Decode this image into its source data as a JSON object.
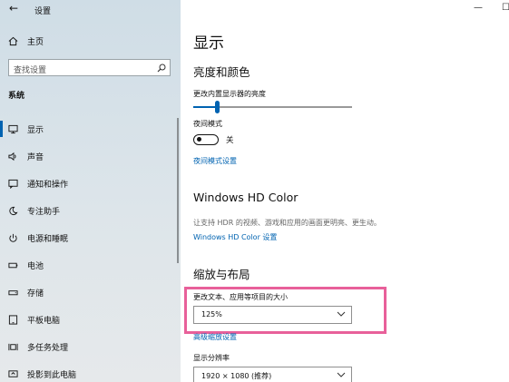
{
  "app": {
    "title": "设置",
    "back_icon": "back-arrow-icon"
  },
  "sidebar": {
    "home_label": "主页",
    "search_placeholder": "查找设置",
    "section_title": "系统",
    "items": [
      {
        "label": "显示",
        "icon": "display-icon",
        "active": true
      },
      {
        "label": "声音",
        "icon": "speaker-icon"
      },
      {
        "label": "通知和操作",
        "icon": "notification-icon"
      },
      {
        "label": "专注助手",
        "icon": "moon-icon"
      },
      {
        "label": "电源和睡眠",
        "icon": "power-icon"
      },
      {
        "label": "电池",
        "icon": "battery-icon"
      },
      {
        "label": "存储",
        "icon": "storage-icon"
      },
      {
        "label": "平板电脑",
        "icon": "tablet-icon"
      },
      {
        "label": "多任务处理",
        "icon": "multitask-icon"
      },
      {
        "label": "投影到此电脑",
        "icon": "project-icon"
      }
    ]
  },
  "main": {
    "page_title": "显示",
    "brightness": {
      "heading": "亮度和颜色",
      "slider_label": "更改内置显示器的亮度",
      "slider_value": 0.15,
      "night_light_label": "夜间模式",
      "night_light_state": "关",
      "night_light_settings_link": "夜间模式设置"
    },
    "hdr": {
      "heading": "Windows HD Color",
      "description": "让支持 HDR 的视频、游戏和应用的画面更明亮、更生动。",
      "settings_link": "Windows HD Color 设置"
    },
    "scale": {
      "heading": "缩放与布局",
      "size_label": "更改文本、应用等项目的大小",
      "size_value": "125%",
      "advanced_link": "高级缩放设置",
      "resolution_label": "显示分辨率",
      "resolution_value": "1920 × 1080 (推荐)"
    }
  },
  "colors": {
    "accent": "#0063b1",
    "highlight": "#e8609a"
  }
}
